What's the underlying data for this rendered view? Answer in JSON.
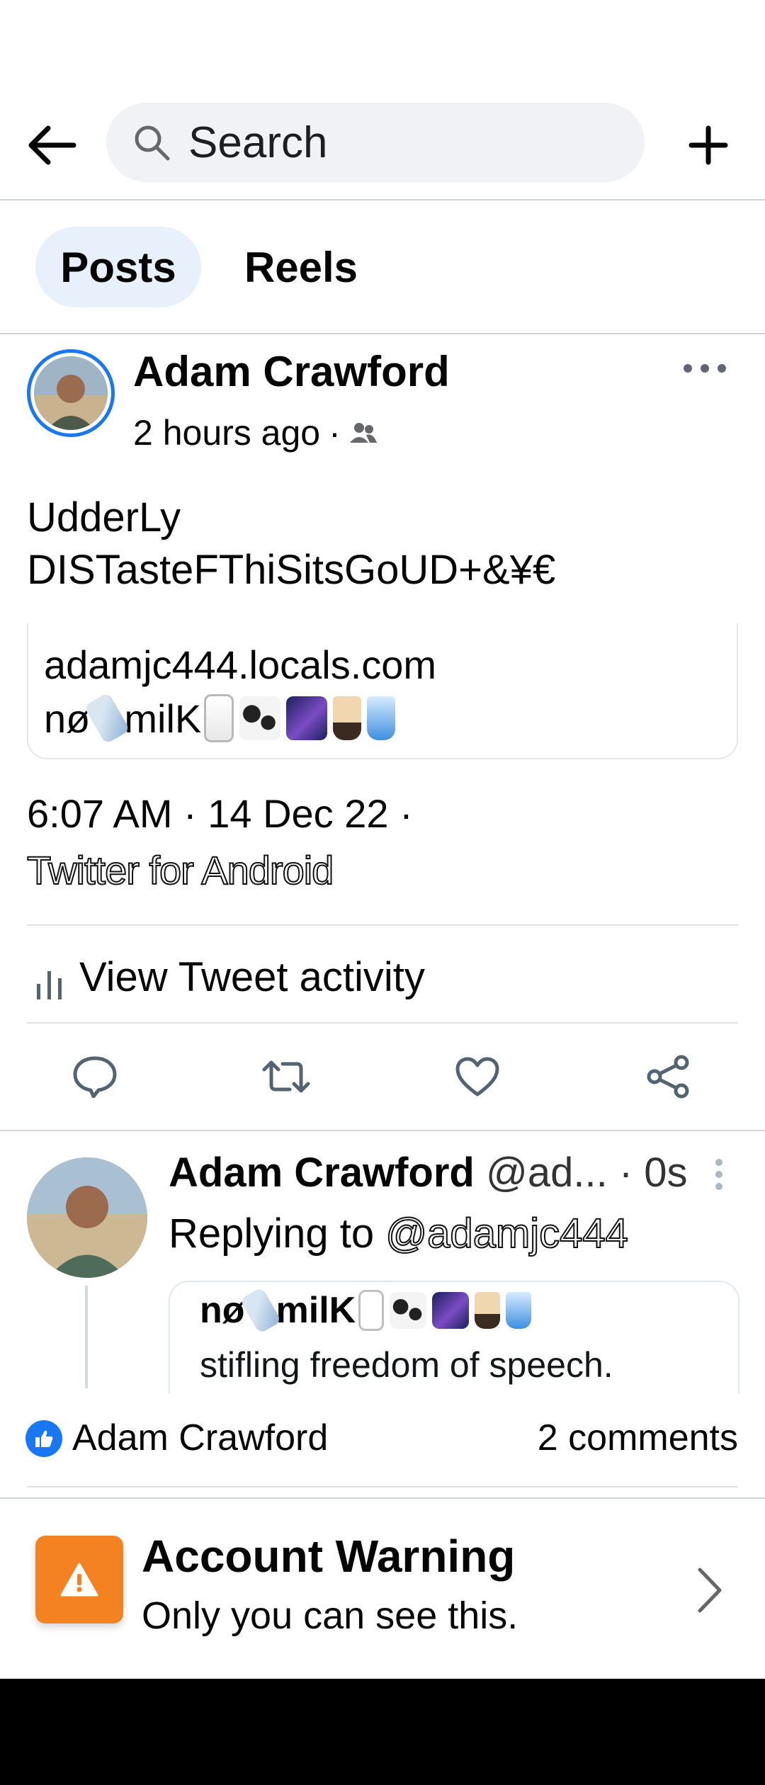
{
  "topbar": {
    "back_icon": "arrow-left-icon",
    "search_icon": "search-icon",
    "search_placeholder": "Search",
    "add_icon": "plus-icon"
  },
  "tabs": [
    {
      "label": "Posts",
      "active": true
    },
    {
      "label": "Reels",
      "active": false
    }
  ],
  "post": {
    "author": "Adam Crawford",
    "time": "2 hours ago",
    "separator": "·",
    "audience_icon": "friends-icon",
    "more_icon": "more-horizontal-icon",
    "text_line1": "UdderLy",
    "text_line2": "DISTasteFThiSitsGoUD+&¥€",
    "card": {
      "url": "adamjc444.locals.com",
      "name_part1": "nø",
      "name_part2": "milK"
    },
    "tweet_time": "6:07 AM · 14 Dec 22 ·",
    "tweet_source": "Twitter for Android",
    "activity_label": "View Tweet activity",
    "action_icons": [
      "reply-icon",
      "retweet-icon",
      "heart-icon",
      "share-icon"
    ]
  },
  "reply": {
    "author": "Adam Crawford",
    "handle": "@ad...",
    "time": "· 0s",
    "replying_prefix": "Replying to",
    "replying_handle": "@adamjc444",
    "quote_name_part1": "nø",
    "quote_name_part2": "milK",
    "quote_text": "stifling freedom of speech."
  },
  "reactions": {
    "liker": "Adam Crawford",
    "comments": "2 comments"
  },
  "warning": {
    "title": "Account Warning",
    "subtitle": "Only you can see this."
  },
  "colors": {
    "brand_blue": "#1877f2",
    "warning_orange": "#f58220",
    "search_bg": "#f0f2f5",
    "tab_active_bg": "#e7f0fb"
  }
}
